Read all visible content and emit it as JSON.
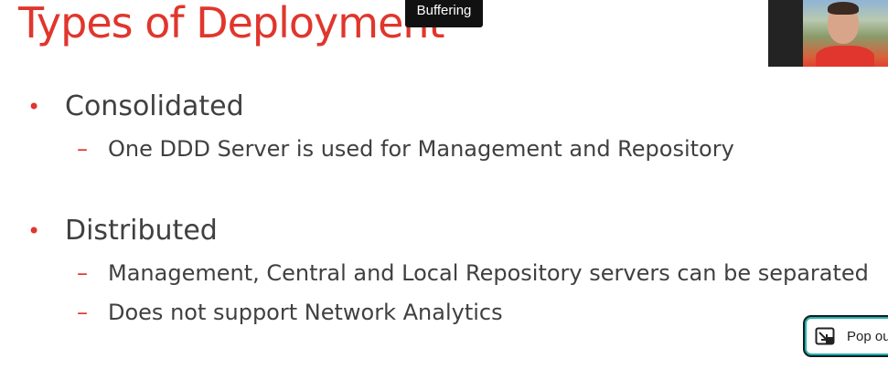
{
  "slide": {
    "title": "Types of Deployment",
    "bullets": [
      {
        "text": "Consolidated",
        "subitems": [
          "One DDD Server is used for Management and Repository"
        ]
      },
      {
        "text": "Distributed",
        "subitems": [
          "Management, Central and Local Repository servers can be separated",
          "Does not support Network Analytics"
        ]
      }
    ],
    "bullet_glyph": "•",
    "sub_glyph": "–",
    "accent_color": "#e0362d",
    "text_color": "#404040"
  },
  "player": {
    "buffering_label": "Buffering",
    "popout_label": "Pop out",
    "popout_icon": "popout-icon",
    "popout_border_color": "#1fb3b0"
  },
  "video": {
    "icon": "participant-video-thumbnail"
  }
}
